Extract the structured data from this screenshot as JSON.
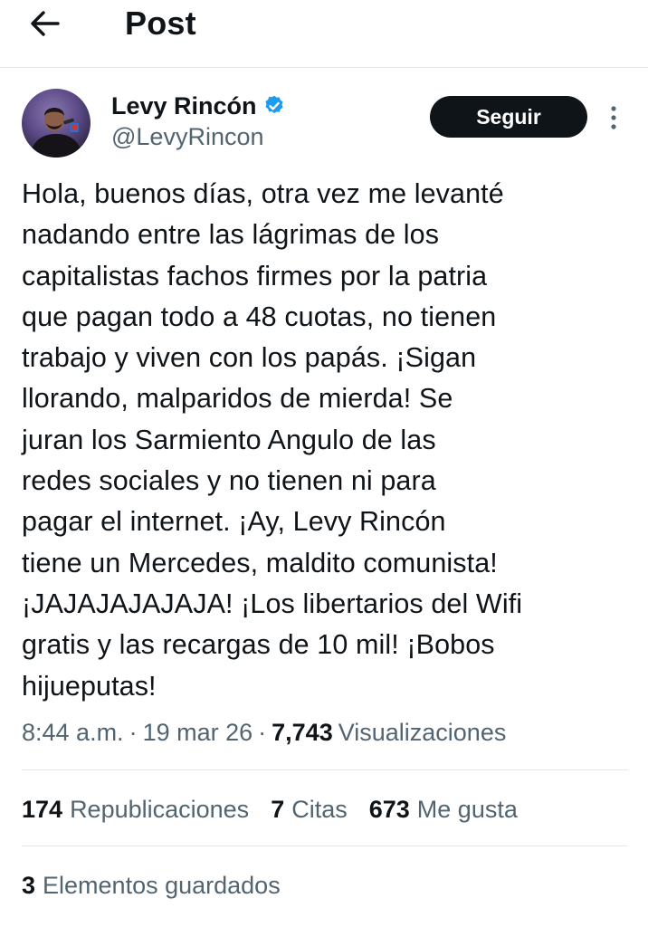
{
  "header": {
    "title": "Post",
    "back_icon": "arrow-left-icon"
  },
  "author": {
    "name": "Levy Rincón",
    "handle": "@LevyRincon",
    "verified": true,
    "verified_color": "#1d9bf0",
    "follow_label": "Seguir",
    "more_icon": "more-vertical-icon"
  },
  "post": {
    "text": "Hola, buenos días, otra vez me levanté\nnadando entre las lágrimas de los\ncapitalistas fachos firmes por la patria\nque pagan todo a 48 cuotas, no tienen\ntrabajo y viven con los papás. ¡Sigan\nllorando, malparidos de mierda! Se\njuran los Sarmiento Angulo de las\nredes sociales y no tienen ni para\npagar el internet. ¡Ay, Levy Rincón\ntiene un Mercedes, maldito comunista!\n¡JAJAJAJAJAJA! ¡Los libertarios del Wifi\ngratis y las recargas de 10 mil! ¡Bobos\nhijueputas!",
    "time": "8:44 a.m.",
    "separator": "·",
    "date": "19 mar 26",
    "views_count": "7,743",
    "views_label": "Visualizaciones"
  },
  "stats": {
    "reposts_count": "174",
    "reposts_label": "Republicaciones",
    "quotes_count": "7",
    "quotes_label": "Citas",
    "likes_count": "673",
    "likes_label": "Me gusta"
  },
  "bookmarks": {
    "count": "3",
    "label": "Elementos guardados"
  }
}
